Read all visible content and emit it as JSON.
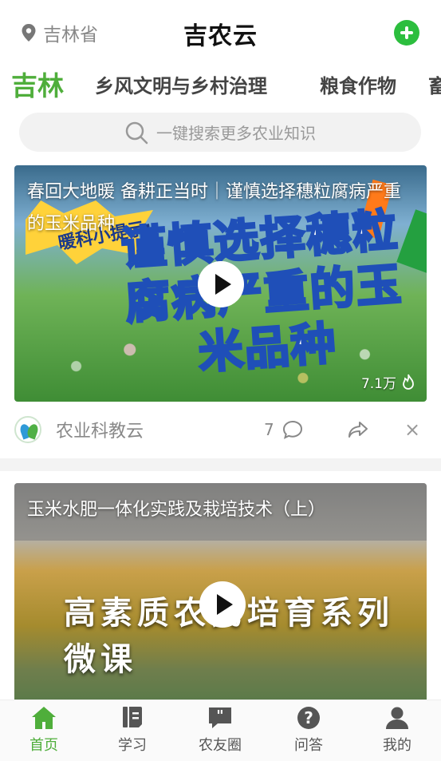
{
  "header": {
    "location": "吉林省",
    "title": "吉农云"
  },
  "tabs": [
    {
      "label": "吉林",
      "active": true
    },
    {
      "label": "乡风文明与乡村治理",
      "active": false
    },
    {
      "label": "粮食作物",
      "active": false
    },
    {
      "label": "畜",
      "active": false
    }
  ],
  "search": {
    "placeholder": "一键搜索更多农业知识"
  },
  "feed": [
    {
      "title": "春回大地暖 备耕正当时｜谨慎选择穗粒腐病严重的玉米品种",
      "thumb_burst": "暖科小提示:",
      "thumb_headline": "谨慎选择穗粒腐病严重的玉米品种",
      "views": "7.1万",
      "source": "农业科教云",
      "comments": "7"
    },
    {
      "title": "玉米水肥一体化实践及栽培技术（上）",
      "thumb_headline": "高素质农民培育系列微课"
    }
  ],
  "nav": [
    {
      "label": "首页",
      "icon": "home-icon",
      "active": true
    },
    {
      "label": "学习",
      "icon": "book-icon",
      "active": false
    },
    {
      "label": "农友圈",
      "icon": "chat-quote-icon",
      "active": false
    },
    {
      "label": "问答",
      "icon": "question-icon",
      "active": false
    },
    {
      "label": "我的",
      "icon": "user-icon",
      "active": false
    }
  ],
  "colors": {
    "accent": "#4fae3b",
    "add_button": "#2cbe3e"
  }
}
